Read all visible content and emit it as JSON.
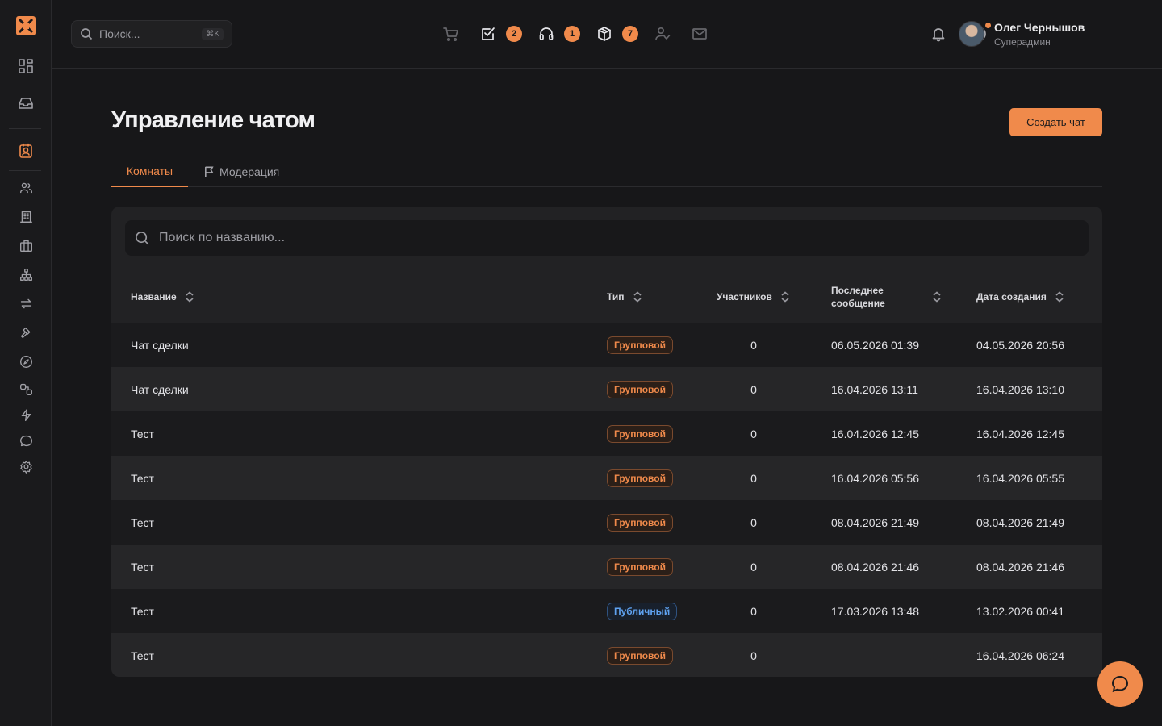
{
  "header": {
    "search_placeholder": "Поиск...",
    "search_shortcut": "⌘K",
    "badges": {
      "tasks": "2",
      "support": "1",
      "packages": "7"
    },
    "user": {
      "name": "Олег Чернышов",
      "role": "Суперадмин"
    }
  },
  "page": {
    "title": "Управление чатом",
    "create_button": "Создать чат",
    "tabs": [
      {
        "label": "Комнаты",
        "active": true
      },
      {
        "label": "Модерация",
        "active": false
      }
    ]
  },
  "table": {
    "search_placeholder": "Поиск по названию...",
    "columns": {
      "name": "Название",
      "type": "Тип",
      "members": "Участников",
      "last_message_1": "Последнее",
      "last_message_2": "сообщение",
      "created": "Дата создания"
    },
    "rows": [
      {
        "name": "Чат сделки",
        "type": "Групповой",
        "type_kind": "group",
        "members": "0",
        "last": "06.05.2026 01:39",
        "created": "04.05.2026 20:56"
      },
      {
        "name": "Чат сделки",
        "type": "Групповой",
        "type_kind": "group",
        "members": "0",
        "last": "16.04.2026 13:11",
        "created": "16.04.2026 13:10"
      },
      {
        "name": "Тест",
        "type": "Групповой",
        "type_kind": "group",
        "members": "0",
        "last": "16.04.2026 12:45",
        "created": "16.04.2026 12:45"
      },
      {
        "name": "Тест",
        "type": "Групповой",
        "type_kind": "group",
        "members": "0",
        "last": "16.04.2026 05:56",
        "created": "16.04.2026 05:55"
      },
      {
        "name": "Тест",
        "type": "Групповой",
        "type_kind": "group",
        "members": "0",
        "last": "08.04.2026 21:49",
        "created": "08.04.2026 21:49"
      },
      {
        "name": "Тест",
        "type": "Групповой",
        "type_kind": "group",
        "members": "0",
        "last": "08.04.2026 21:46",
        "created": "08.04.2026 21:46"
      },
      {
        "name": "Тест",
        "type": "Публичный",
        "type_kind": "public",
        "members": "0",
        "last": "17.03.2026 13:48",
        "created": "13.02.2026 00:41"
      },
      {
        "name": "Тест",
        "type": "Групповой",
        "type_kind": "group",
        "members": "0",
        "last": "–",
        "created": "16.04.2026 06:24"
      }
    ]
  },
  "colors": {
    "accent": "#f08a4b",
    "public": "#5fa2f0",
    "background": "#171719"
  }
}
